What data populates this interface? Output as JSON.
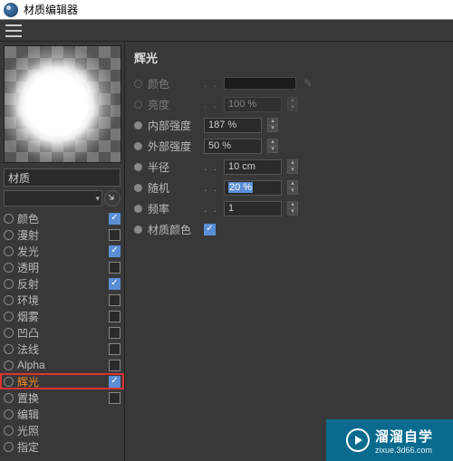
{
  "window": {
    "title": "材质编辑器"
  },
  "material": {
    "name": "材质"
  },
  "channels": [
    {
      "label": "颜色",
      "checked": true,
      "hasCheckbox": true,
      "active": false
    },
    {
      "label": "漫射",
      "checked": false,
      "hasCheckbox": true,
      "active": false
    },
    {
      "label": "发光",
      "checked": true,
      "hasCheckbox": true,
      "active": false
    },
    {
      "label": "透明",
      "checked": false,
      "hasCheckbox": true,
      "active": false
    },
    {
      "label": "反射",
      "checked": true,
      "hasCheckbox": true,
      "active": false
    },
    {
      "label": "环境",
      "checked": false,
      "hasCheckbox": true,
      "active": false
    },
    {
      "label": "烟雾",
      "checked": false,
      "hasCheckbox": true,
      "active": false
    },
    {
      "label": "凹凸",
      "checked": false,
      "hasCheckbox": true,
      "active": false
    },
    {
      "label": "法线",
      "checked": false,
      "hasCheckbox": true,
      "active": false
    },
    {
      "label": "Alpha",
      "checked": false,
      "hasCheckbox": true,
      "active": false
    },
    {
      "label": "辉光",
      "checked": true,
      "hasCheckbox": true,
      "active": true,
      "highlighted": true
    },
    {
      "label": "置换",
      "checked": false,
      "hasCheckbox": true,
      "active": false
    },
    {
      "label": "编辑",
      "checked": false,
      "hasCheckbox": false,
      "active": false
    },
    {
      "label": "光照",
      "checked": false,
      "hasCheckbox": false,
      "active": false
    },
    {
      "label": "指定",
      "checked": false,
      "hasCheckbox": false,
      "active": false
    }
  ],
  "panel": {
    "title": "辉光",
    "color_label": "颜色",
    "brightness_label": "亮度",
    "brightness_value": "100 %",
    "inner_label": "内部强度",
    "inner_value": "187 %",
    "outer_label": "外部强度",
    "outer_value": "50 %",
    "radius_label": "半径",
    "radius_value": "10 cm",
    "random_label": "随机",
    "random_value": "20 %",
    "freq_label": "频率",
    "freq_value": "1",
    "matcolor_label": "材质颜色"
  },
  "watermark": {
    "main": "溜溜自学",
    "sub": "zixue.3d66.com"
  }
}
